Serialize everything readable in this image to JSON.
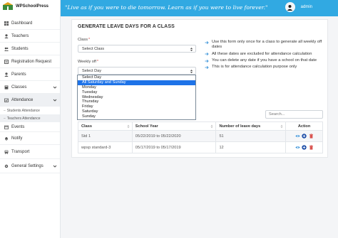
{
  "brand": {
    "name": "WPSchoolPress"
  },
  "header": {
    "quote": "\"Live as if you were to die tomorrow. Learn as if you were to live forever.\"",
    "user_name": "admin"
  },
  "sidebar": {
    "items": [
      {
        "label": "Dashboard",
        "icon": "dashboard-icon"
      },
      {
        "label": "Teachers",
        "icon": "user-icon"
      },
      {
        "label": "Students",
        "icon": "users-icon"
      },
      {
        "label": "Registration Request",
        "icon": "registration-icon"
      },
      {
        "label": "Parents",
        "icon": "user-icon"
      },
      {
        "label": "Classes",
        "icon": "book-icon"
      },
      {
        "label": "Attendance",
        "icon": "attendance-icon"
      },
      {
        "label": "Events",
        "icon": "calendar-icon"
      },
      {
        "label": "Notify",
        "icon": "bell-icon"
      },
      {
        "label": "Transport",
        "icon": "bus-icon"
      },
      {
        "label": "General Settings",
        "icon": "gear-icon"
      }
    ],
    "attendance_sub": [
      "Students Attendance",
      "Teachers Attendance"
    ]
  },
  "panel": {
    "title": "GENERATE LEAVE DAYS FOR A CLASS",
    "class_label": "Class",
    "class_value": "Select Class",
    "weekly_off_label": "Weekly off",
    "weekly_off_value": "Select Day",
    "required_mark": "*",
    "dropdown_options": [
      "Select Day",
      "All Saturday and Sunday",
      "Monday",
      "Tuesday",
      "Wednesday",
      "Thursday",
      "Friday",
      "Saturday",
      "Sunday"
    ],
    "dropdown_highlighted_index": 1,
    "notes": [
      "Use this form only once for a class to generate all weekly off dates",
      "All these dates are excluded for attendance calculation",
      "You can delete any date if you have a school on that date",
      "This is for attendance calculation purpose only"
    ],
    "search_placeholder": "Search...",
    "table": {
      "headers": [
        "Class",
        "School Year",
        "Number of leave days",
        "Action"
      ],
      "rows": [
        {
          "class": "Std 1",
          "school_year": "05/22/2019 to 05/22/2020",
          "leave_days": "51"
        },
        {
          "class": "wpsp standard-3",
          "school_year": "05/17/2019 to 05/17/2019",
          "leave_days": "12"
        }
      ]
    }
  },
  "colors": {
    "header_bg": "#31a9e2",
    "selected_option": "#1e73e8",
    "view_icon": "#2a8bd6",
    "add_icon": "#1f4fa8",
    "delete_icon": "#d9534f"
  }
}
